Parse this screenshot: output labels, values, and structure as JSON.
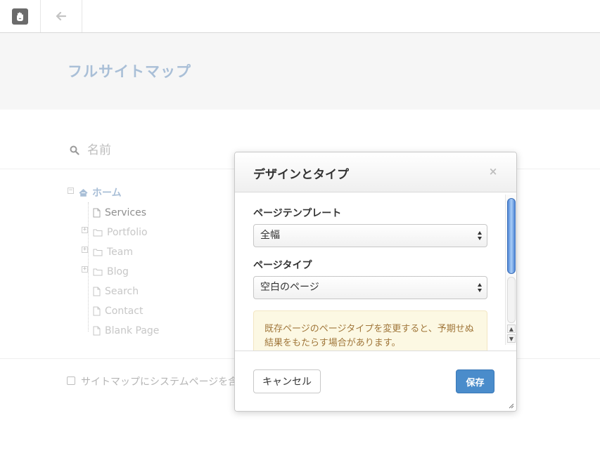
{
  "page": {
    "title": "フルサイトマップ"
  },
  "search": {
    "placeholder": "名前"
  },
  "tree": {
    "root": {
      "label": "ホーム"
    },
    "children": [
      {
        "label": "Services",
        "type": "page",
        "expandable": false
      },
      {
        "label": "Portfolio",
        "type": "folder",
        "expandable": true
      },
      {
        "label": "Team",
        "type": "folder",
        "expandable": true
      },
      {
        "label": "Blog",
        "type": "folder",
        "expandable": true
      },
      {
        "label": "Search",
        "type": "page",
        "expandable": false
      },
      {
        "label": "Contact",
        "type": "page",
        "expandable": false
      },
      {
        "label": "Blank Page",
        "type": "page",
        "expandable": false
      }
    ]
  },
  "footer_option": {
    "label": "サイトマップにシステムページを含",
    "checked": false
  },
  "modal": {
    "title": "デザインとタイプ",
    "template_label": "ページテンプレート",
    "template_value": "全幅",
    "type_label": "ページタイプ",
    "type_value": "空白のページ",
    "warning": "既存ページのページタイプを変更すると、予期せぬ結果をもたらす場合があります。",
    "cancel_label": "キャンセル",
    "save_label": "保存"
  },
  "icons": {
    "logo": "concrete5-hand-logo",
    "back": "arrow-left-icon",
    "search": "search-icon",
    "home": "home-icon",
    "page": "file-icon",
    "folder": "folder-icon",
    "close": "close-icon",
    "select_arrows": "sort-arrows-icon",
    "resize": "resize-grip-icon"
  },
  "colors": {
    "title_accent": "#a9bfd7",
    "primary_button": "#4a8ccb",
    "warning_bg": "#fcf8e3",
    "warning_text": "#a0763a"
  }
}
